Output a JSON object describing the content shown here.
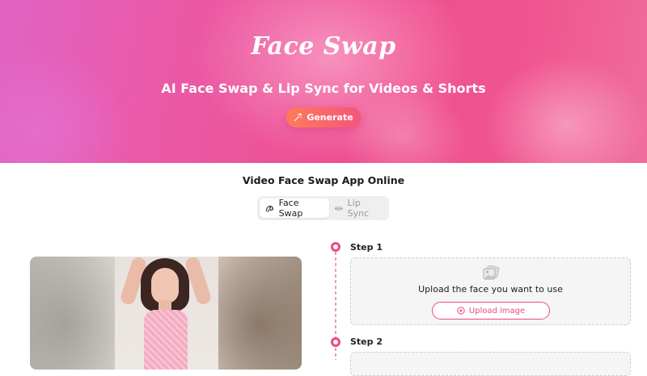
{
  "hero": {
    "logo": "Face Swap",
    "tagline": "AI Face Swap & Lip Sync for Videos & Shorts",
    "generate_label": "Generate",
    "colors": {
      "accent": "#ef4a7e",
      "gradient_left": "#e063c4",
      "gradient_right": "#ef6d9c"
    }
  },
  "main": {
    "title": "Video Face Swap App Online",
    "tabs": [
      {
        "label": "Face Swap",
        "icon": "face-swap-icon",
        "active": true
      },
      {
        "label": "Lip Sync",
        "icon": "lips-icon",
        "active": false
      }
    ]
  },
  "steps": [
    {
      "label": "Step 1",
      "upload_text": "Upload the face you want to use",
      "button_label": "Upload image",
      "icon": "image-icon",
      "button_icon": "plus-circle-icon"
    },
    {
      "label": "Step 2"
    }
  ]
}
